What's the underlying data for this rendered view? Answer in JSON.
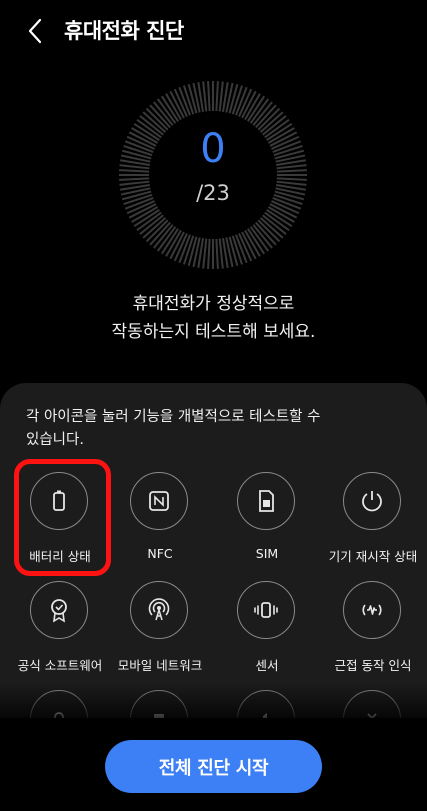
{
  "header": {
    "title": "휴대전화 진단"
  },
  "progress": {
    "completed": "0",
    "total": "/23"
  },
  "description": {
    "line1": "휴대전화가 정상적으로",
    "line2": "작동하는지 테스트해 보세요."
  },
  "panel": {
    "instruction_line1": "각 아이콘을 눌러 기능을 개별적으로 테스트할 수",
    "instruction_line2": "있습니다.",
    "tests": [
      {
        "label": "배터리 상태",
        "icon": "battery-icon"
      },
      {
        "label": "NFC",
        "icon": "nfc-icon"
      },
      {
        "label": "SIM",
        "icon": "sim-card-icon"
      },
      {
        "label": "기기 재시작 상태",
        "icon": "restart-icon"
      },
      {
        "label": "공식 소프트웨어",
        "icon": "certified-badge-icon"
      },
      {
        "label": "모바일 네트워크",
        "icon": "antenna-icon"
      },
      {
        "label": "센서",
        "icon": "vibration-sensor-icon"
      },
      {
        "label": "근접 동작 인식",
        "icon": "proximity-icon"
      },
      {
        "label": "",
        "icon": "location-icon"
      },
      {
        "label": "",
        "icon": "device-icon"
      },
      {
        "label": "",
        "icon": "speaker-icon"
      },
      {
        "label": "",
        "icon": "vibrate-icon"
      }
    ]
  },
  "start_button": {
    "label": "전체 진단 시작"
  },
  "colors": {
    "accent": "#3d7ff5",
    "highlight": "#ff1212",
    "panel": "#1c1c1c"
  }
}
